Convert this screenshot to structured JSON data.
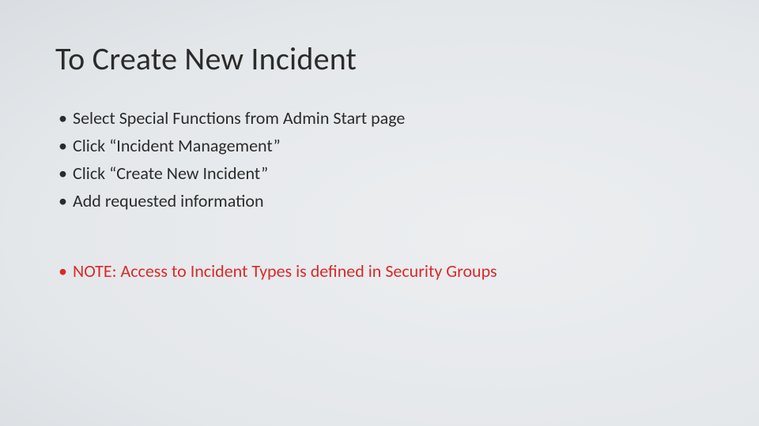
{
  "slide": {
    "title": "To Create New Incident",
    "bullets": [
      "Select Special Functions from Admin Start page",
      "Click “Incident Management”",
      "Click “Create New Incident”",
      "Add requested information"
    ],
    "note": "NOTE: Access to Incident Types is defined in Security Groups"
  },
  "colors": {
    "text": "#2b2b2b",
    "note": "#d82a2a"
  }
}
